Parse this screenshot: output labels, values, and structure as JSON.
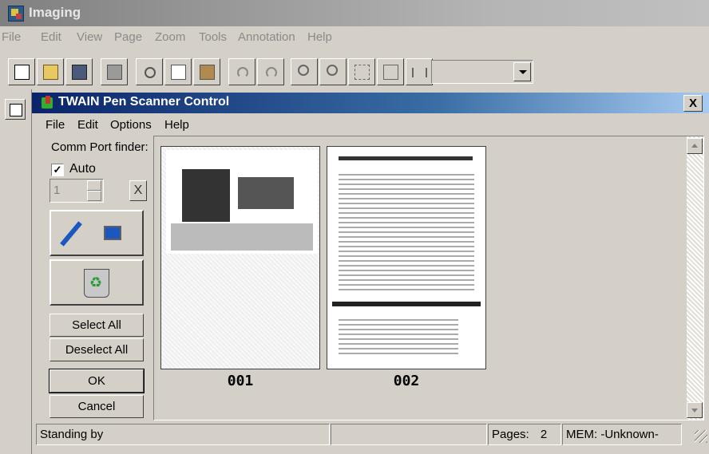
{
  "app": {
    "title": "Imaging"
  },
  "app_menu": [
    "File",
    "Edit",
    "View",
    "Page",
    "Zoom",
    "Tools",
    "Annotation",
    "Help"
  ],
  "toolbar": {
    "buttons": [
      "new-icon",
      "open-icon",
      "save-icon",
      "print-icon",
      "cut-icon",
      "copy-icon",
      "paste-icon",
      "undo-icon",
      "redo-icon",
      "zoom-in-icon",
      "zoom-out-icon",
      "drag-icon",
      "best-fit-icon",
      "fit-width-icon"
    ],
    "zoom_value": ""
  },
  "dialog": {
    "title": "TWAIN Pen Scanner Control",
    "close_label": "X",
    "menu": [
      "File",
      "Edit",
      "Options",
      "Help"
    ],
    "comm_port_label": "Comm Port finder:",
    "auto_checked": true,
    "auto_check_mark": "✓",
    "auto_label": "Auto",
    "port_value": "1",
    "clear_label": "X",
    "select_all": "Select All",
    "deselect_all": "Deselect All",
    "ok": "OK",
    "cancel": "Cancel",
    "pages": [
      {
        "label": "001"
      },
      {
        "label": "002"
      }
    ]
  },
  "status": {
    "message": "Standing by",
    "pages_label": "Pages:",
    "pages_count": "2",
    "mem": "MEM: -Unknown-"
  }
}
